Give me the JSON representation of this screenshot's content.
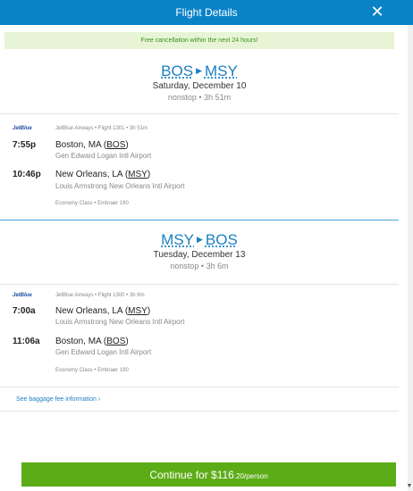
{
  "header": {
    "title": "Flight Details",
    "close_glyph": "✕"
  },
  "notice": "Free cancellation within the next 24 hours!",
  "outbound": {
    "origin": "BOS",
    "destination": "MSY",
    "date": "Saturday, December 10",
    "summary": "nonstop • 3h 51m",
    "airline_logo": "JetBlue",
    "flight_meta": "JetBlue Airways • Flight 1301 • 3h 51m",
    "depart": {
      "time": "7:55p",
      "city": "Boston, MA",
      "code": "BOS",
      "airport": "Gen Edward Logan Intl Airport"
    },
    "arrive": {
      "time": "10:46p",
      "city": "New Orleans, LA",
      "code": "MSY",
      "airport": "Louis Armstrong New Orleans Intl Airport"
    },
    "cabin": "Economy Class • Embraer 190"
  },
  "return": {
    "origin": "MSY",
    "destination": "BOS",
    "date": "Tuesday, December 13",
    "summary": "nonstop • 3h 6m",
    "airline_logo": "JetBlue",
    "flight_meta": "JetBlue Airways • Flight 1300 • 3h 6m",
    "depart": {
      "time": "7:00a",
      "city": "New Orleans, LA",
      "code": "MSY",
      "airport": "Louis Armstrong New Orleans Intl Airport"
    },
    "arrive": {
      "time": "11:06a",
      "city": "Boston, MA",
      "code": "BOS",
      "airport": "Gen Edward Logan Intl Airport"
    },
    "cabin": "Economy Class • Embraer 190"
  },
  "baggage_link": "See baggage fee information ›",
  "continue": {
    "label": "Continue for $116",
    "cents": ".20/person"
  },
  "colors": {
    "header": "#0a83c6",
    "accent": "#1a7fc1",
    "notice_bg": "#e7f5d6",
    "notice_text": "#3e8f1b",
    "button": "#5cac17"
  },
  "icons": {
    "close": "close-icon",
    "route_arrow": "triangle-right-icon",
    "scroll_down": "chevron-down-icon"
  }
}
